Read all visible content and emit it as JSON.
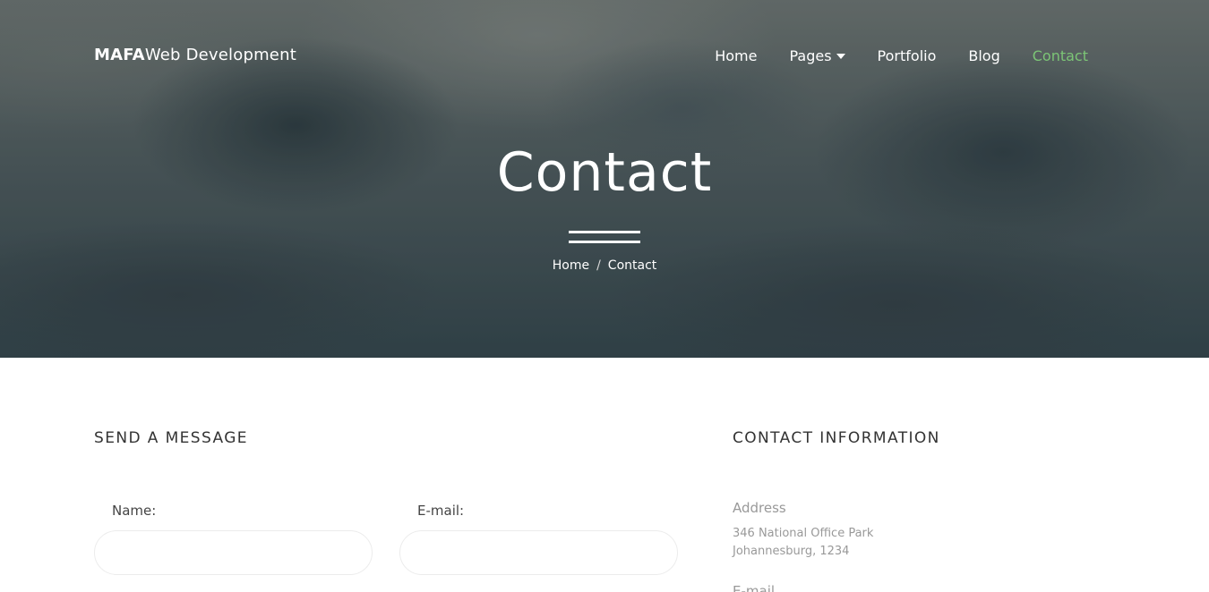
{
  "nav": {
    "brand_bold": "MAFA",
    "brand_rest": "Web Development",
    "items": [
      {
        "label": "Home"
      },
      {
        "label": "Pages"
      },
      {
        "label": "Portfolio"
      },
      {
        "label": "Blog"
      },
      {
        "label": "Contact"
      }
    ],
    "active_color": "#7cc576"
  },
  "hero": {
    "title": "Contact",
    "breadcrumb": {
      "home": "Home",
      "separator": "/",
      "current": "Contact"
    }
  },
  "form": {
    "heading": "SEND A MESSAGE",
    "name_label": "Name:",
    "name_value": "",
    "email_label": "E-mail:",
    "email_value": ""
  },
  "info": {
    "heading": "CONTACT INFORMATION",
    "address_label": "Address",
    "address_line1": "346 National Office Park",
    "address_line2": "Johannesburg, 1234",
    "next_label": "E-mail"
  }
}
